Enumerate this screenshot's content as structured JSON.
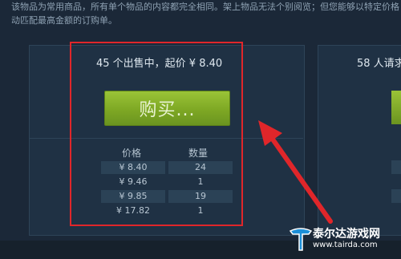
{
  "notice": {
    "line1": "该物品为常用商品，所有单个物品的内容都完全相同。架上物品无法个别阅览；但您能够以特定价格",
    "line2": "动匹配最高金额的订购单。"
  },
  "listing": {
    "header": "45 个出售中，起价 ¥ 8.40",
    "buy_label": "购买...",
    "col_price": "价格",
    "col_qty": "数量",
    "rows": [
      {
        "price": "¥ 8.40",
        "qty": "24"
      },
      {
        "price": "¥ 9.46",
        "qty": "1"
      },
      {
        "price": "¥ 9.85",
        "qty": "19"
      },
      {
        "price": "¥ 17.82",
        "qty": "1"
      }
    ]
  },
  "buy_orders": {
    "header": "58 人请求"
  },
  "watermark": {
    "title": "泰尔达游戏网",
    "url": "www.tairda.com"
  },
  "colors": {
    "background": "#1b2838",
    "buy_button": "#7ea824",
    "highlight": "#e0262a"
  }
}
